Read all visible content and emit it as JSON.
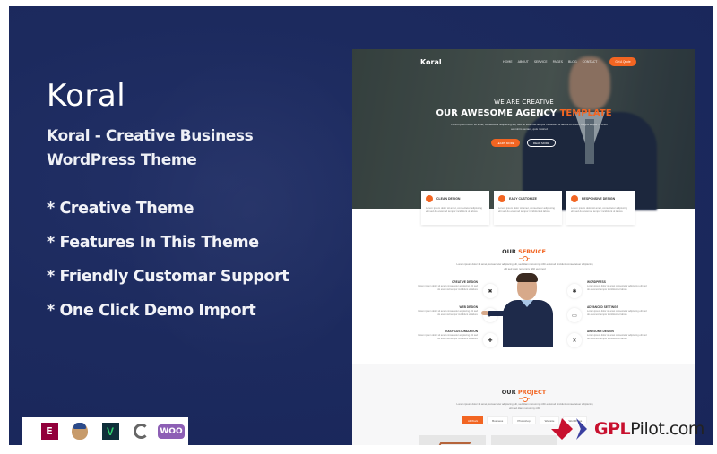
{
  "banner": {
    "brand": "Koral",
    "subtitle_line1": "Koral - Creative Business",
    "subtitle_line2": "WordPress Theme",
    "features": [
      "* Creative Theme",
      "* Features In This Theme",
      "* Friendly Customar Support",
      "* One Click Demo Import"
    ],
    "plugins": [
      {
        "name": "elementor-icon",
        "label": "E"
      },
      {
        "name": "mailchimp-icon",
        "label": ""
      },
      {
        "name": "visual-composer-icon",
        "label": "V"
      },
      {
        "name": "revolution-slider-icon",
        "label": ""
      },
      {
        "name": "woocommerce-icon",
        "label": "WOO"
      }
    ],
    "colors": {
      "background": "#1c2a5e",
      "accent": "#f26522"
    }
  },
  "preview": {
    "nav": {
      "logo": "Koral",
      "items": [
        "HOME",
        "ABOUT",
        "SERVICE",
        "PAGES",
        "BLOG",
        "CONTACT"
      ],
      "cta": "Get A Quote"
    },
    "hero": {
      "kicker": "WE ARE CREATIVE",
      "title_main": "OUR AWESOME AGENCY ",
      "title_accent": "TEMPLATE",
      "description": "Lorem ipsum dolor sit amet, consectetur adipiscing elit, sed do eiusmod tempor incididunt ut labore et dolore magna aliqua. Ut enim ad minim veniam, quis nostrud",
      "primary_button": "LEARN MORE",
      "secondary_button": "READ MORE"
    },
    "feature_cards": [
      {
        "title": "CLEAN DESIGN",
        "text": "Lorem ipsum dolor sit amet, consectetur adipiscing elit sed do eiusmod tempor incididunt ut labore"
      },
      {
        "title": "EASY CUSTOMIZE",
        "text": "Lorem ipsum dolor sit amet, consectetur adipiscing elit sed do eiusmod tempor incididunt ut labore"
      },
      {
        "title": "RESPONSIVE DESIGN",
        "text": "Lorem ipsum dolor sit amet, consectetur adipiscing elit sed do eiusmod tempor incididunt ut labore"
      }
    ],
    "service": {
      "title_main": "OUR ",
      "title_accent": "SERVICE",
      "description": "Lorem ipsum dolor sit amet, consectetur adipiscing elit, sed diam nonummy nibh euismod tincidunt consectetuer adipiscing elit sed diam nonummy nibh euismod",
      "left_items": [
        {
          "title": "CREATIVE DESIGN",
          "text": "Lorem ipsum dolor sit amet consectetur adipiscing elit sed do eiusmod tempor incididunt ut labore",
          "icon": "✖"
        },
        {
          "title": "WEB DESIGN",
          "text": "Lorem ipsum dolor sit amet consectetur adipiscing elit sed do eiusmod tempor incididunt ut labore",
          "icon": "➤"
        },
        {
          "title": "EASY CUSTOMIZATION",
          "text": "Lorem ipsum dolor sit amet consectetur adipiscing elit sed do eiusmod tempor incididunt ut labore",
          "icon": "✚"
        }
      ],
      "right_items": [
        {
          "title": "WORDPRESS",
          "text": "Lorem ipsum dolor sit amet consectetur adipiscing elit sed do eiusmod tempor incididunt ut labore",
          "icon": "✱"
        },
        {
          "title": "ADVANCED SETTINGS",
          "text": "Lorem ipsum dolor sit amet consectetur adipiscing elit sed do eiusmod tempor incididunt ut labore",
          "icon": "▭"
        },
        {
          "title": "AWESOME DESIGN",
          "text": "Lorem ipsum dolor sit amet consectetur adipiscing elit sed do eiusmod tempor incididunt ut labore",
          "icon": "✕"
        }
      ]
    },
    "project": {
      "title_main": "OUR ",
      "title_accent": "PROJECT",
      "description": "Lorem ipsum dolor sit amet, consectetur adipiscing elit, sed diam nonummy nibh euismod tincidunt consectetuer adipiscing elit sed diam nonummy nibh",
      "filters": [
        "All Work",
        "Business",
        "Photoshop",
        "Website",
        "WordPress"
      ],
      "active_filter": "All Work"
    }
  },
  "watermark": {
    "accent": "GPL",
    "rest": "Pilot.com"
  }
}
